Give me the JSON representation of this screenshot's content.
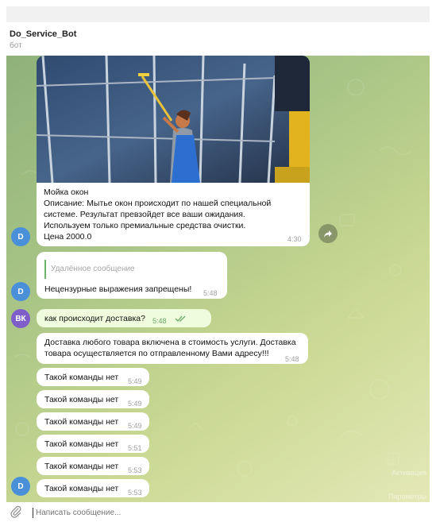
{
  "header": {
    "title": "Do_Service_Bot",
    "subtitle": "бот"
  },
  "photo_message": {
    "caption": [
      "Мойка окон",
      "Описание: Мытье окон происходит по нашей специальной",
      "системе. Результат превзойдет все ваши ожидания.",
      "Используем только премиальные средства очистки.",
      "Цена 2000.0"
    ],
    "time": "4:30",
    "avatar": "D"
  },
  "messages": [
    {
      "reply": "Удалённое сообщение",
      "text": "Нецензурные выражения запрещены!",
      "time": "5:48",
      "avatar": "D"
    },
    {
      "text": "как происходит доставка?",
      "time": "5:48",
      "avatar": "ВК",
      "own": true
    },
    {
      "text_lines": [
        "Доставка любого товара включена в стоимость услуги. Доставка",
        "товара осуществляется по отправленному Вами адресу!!!"
      ],
      "time": "5:48"
    },
    {
      "text": "Такой команды нет",
      "time": "5:49"
    },
    {
      "text": "Такой команды нет",
      "time": "5:49"
    },
    {
      "text": "Такой команды нет",
      "time": "5:49"
    },
    {
      "text": "Такой команды нет",
      "time": "5:51"
    },
    {
      "text": "Такой команды нет",
      "time": "5:53"
    },
    {
      "text": "Такой команды нет",
      "time": "5:53",
      "avatar": "D"
    }
  ],
  "input": {
    "placeholder": "Написать сообщение..."
  },
  "watermark": {
    "line1": "Активация",
    "line2": "Параметры"
  },
  "colors": {
    "bot_avatar": "#4a90d9",
    "user_avatar": "#7e5fc9",
    "own_bubble": "#effdde",
    "read_check": "#6aa865"
  }
}
